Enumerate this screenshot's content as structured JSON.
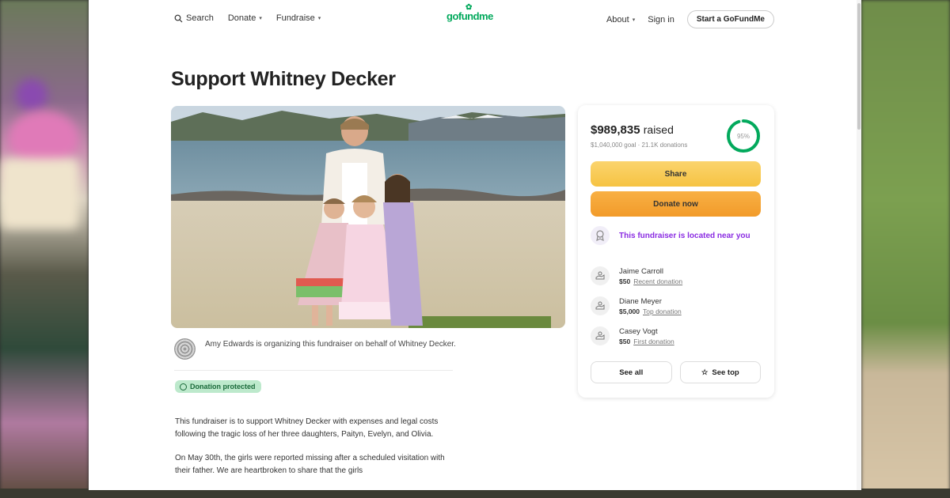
{
  "nav": {
    "search": "Search",
    "donate": "Donate",
    "fundraise": "Fundraise",
    "logo": "gofundme",
    "about": "About",
    "signin": "Sign in",
    "start": "Start a GoFundMe"
  },
  "campaign": {
    "title": "Support Whitney Decker",
    "organizer": "Amy Edwards is organizing this fundraiser on behalf of Whitney Decker.",
    "protected_badge": "Donation protected",
    "story_p1": "This fundraiser is to support Whitney Decker with expenses and legal costs following the tragic loss of her three daughters, Paityn, Evelyn, and Olivia.",
    "story_p2": "On May 30th, the girls were reported missing after a scheduled visitation with their father. We are heartbroken to share that the girls"
  },
  "card": {
    "raised": "$989,835",
    "raised_suffix": "raised",
    "goal": "$1,040,000 goal · 21.1K donations",
    "percent": "95%",
    "progress": 0.95,
    "share": "Share",
    "donate": "Donate now",
    "near": "This fundraiser is located near you",
    "donations": [
      {
        "name": "Jaime Carroll",
        "amount": "$50",
        "tag": "Recent donation"
      },
      {
        "name": "Diane Meyer",
        "amount": "$5,000",
        "tag": "Top donation"
      },
      {
        "name": "Casey Vogt",
        "amount": "$50",
        "tag": "First donation"
      }
    ],
    "see_all": "See all",
    "see_top": "See top"
  },
  "colors": {
    "brand": "#02a95c",
    "share": "#f6c342",
    "donate": "#f29b2a",
    "near": "#8a2be2",
    "protected_bg": "#bde9cc"
  }
}
